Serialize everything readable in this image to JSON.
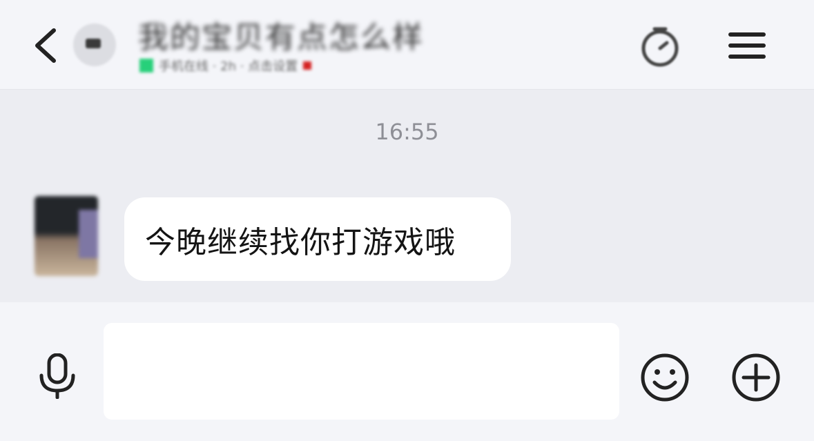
{
  "header": {
    "back_icon": "chevron-left-icon",
    "title": "我的宝贝有点怎么样",
    "subtitle": "手机在线 · 2h · 点击设置",
    "status_color": "#27d07a",
    "right_icons": [
      "timer-icon",
      "menu-icon"
    ]
  },
  "chat": {
    "timestamp": "16:55",
    "messages": [
      {
        "side": "left",
        "text": "今晚继续找你打游戏哦"
      }
    ]
  },
  "input_bar": {
    "voice_icon": "microphone-icon",
    "value": "",
    "placeholder": "",
    "emoji_icon": "smiley-icon",
    "more_icon": "plus-circle-icon"
  },
  "colors": {
    "background": "#ecedf2",
    "bar": "#f4f5f9",
    "bubble": "#ffffff",
    "time_text": "#8e8f96"
  }
}
